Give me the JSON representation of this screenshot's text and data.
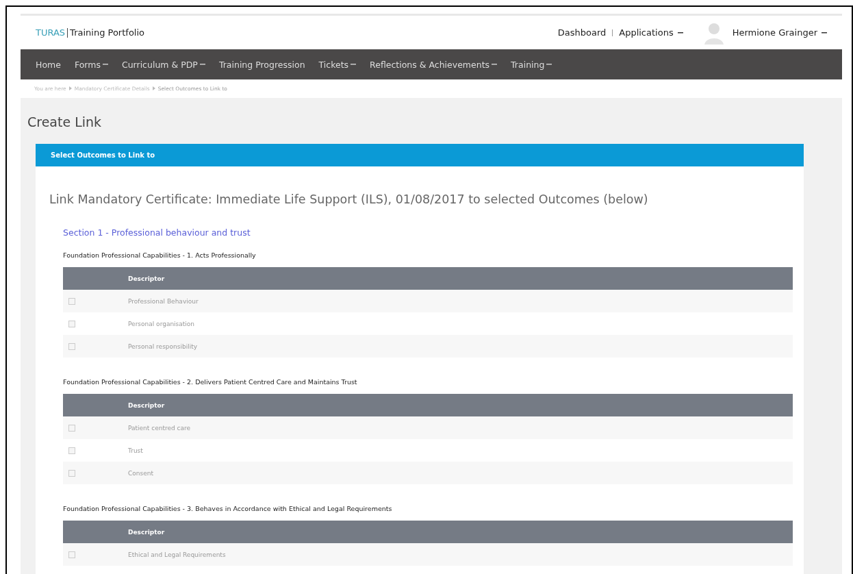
{
  "header": {
    "brand": "TURAS",
    "product": "Training Portfolio",
    "links": [
      {
        "label": "Dashboard",
        "dropdown": false
      },
      {
        "label": "Applications",
        "dropdown": true
      }
    ],
    "user": {
      "name": "Hermione Grainger",
      "dropdown": true
    }
  },
  "nav": [
    {
      "label": "Home",
      "dropdown": false
    },
    {
      "label": "Forms",
      "dropdown": true
    },
    {
      "label": "Curriculum & PDP",
      "dropdown": true
    },
    {
      "label": "Training Progression",
      "dropdown": false
    },
    {
      "label": "Tickets",
      "dropdown": true
    },
    {
      "label": "Reflections & Achievements",
      "dropdown": true
    },
    {
      "label": "Training",
      "dropdown": true
    }
  ],
  "breadcrumb": [
    "You are here",
    "Mandatory Certificate Details",
    "Select Outcomes to Link to"
  ],
  "page_title": "Create Link",
  "panel": {
    "title": "Select Outcomes to Link to",
    "heading": "Link Mandatory Certificate: Immediate Life Support (ILS), 01/08/2017 to selected Outcomes (below)",
    "section": "Section 1 - Professional behaviour and trust",
    "groups": [
      {
        "title": "Foundation Professional Capabilities - 1. Acts Professionally",
        "column": "Descriptor",
        "rows": [
          {
            "label": "Professional Behaviour",
            "checked": false
          },
          {
            "label": "Personal organisation",
            "checked": false
          },
          {
            "label": "Personal responsibility",
            "checked": false
          }
        ]
      },
      {
        "title": "Foundation Professional Capabilities - 2. Delivers Patient Centred Care and Maintains Trust",
        "column": "Descriptor",
        "rows": [
          {
            "label": "Patient centred care",
            "checked": false
          },
          {
            "label": "Trust",
            "checked": false
          },
          {
            "label": "Consent",
            "checked": false
          }
        ]
      },
      {
        "title": "Foundation Professional Capabilities - 3. Behaves in Accordance with Ethical and Legal Requirements",
        "column": "Descriptor",
        "rows": [
          {
            "label": "Ethical and Legal Requirements",
            "checked": false
          }
        ]
      }
    ]
  }
}
